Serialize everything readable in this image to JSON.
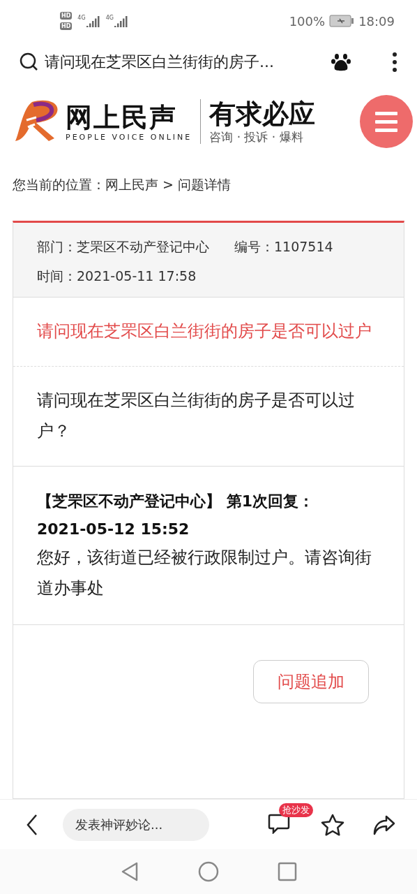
{
  "status_bar": {
    "sim_badges": [
      "HD",
      "HD"
    ],
    "network_labels": [
      "4G",
      "4G"
    ],
    "battery": "100%",
    "time": "18:09"
  },
  "url_bar": {
    "title": "请问现在芝罘区白兰街街的房子..."
  },
  "header": {
    "logo_name": "网上民声",
    "logo_subtitle": "PEOPLE VOICE ONLINE",
    "slogan": "有求必应",
    "slogan_sub": "咨询 · 投诉 · 爆料"
  },
  "breadcrumb": "您当前的位置：网上民声 > 问题详情",
  "detail": {
    "department": "部门：芝罘区不动产登记中心",
    "number": "编号：1107514",
    "time": "时间：2021-05-11 17:58",
    "title": "请问现在芝罘区白兰街街的房子是否可以过户",
    "question": "请问现在芝罘区白兰街街的房子是否可以过户？",
    "reply": {
      "heading": "【芝罘区不动产登记中心】 第1次回复：",
      "time": "2021-05-12 15:52",
      "body": "您好，该街道已经被行政限制过户。请咨询街道办事处"
    },
    "action_button": "问题追加"
  },
  "bottom_bar": {
    "comment_placeholder": "发表神评妙论...",
    "comment_badge": "抢沙发"
  }
}
